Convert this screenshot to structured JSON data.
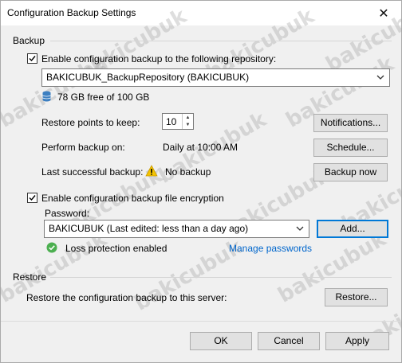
{
  "window": {
    "title": "Configuration Backup Settings",
    "close_glyph": "✕"
  },
  "backup": {
    "group_label": "Backup",
    "enable_label": "Enable configuration backup to the following repository:",
    "enable_checked": true,
    "repository": "BAKICUBUK_BackupRepository (BAKICUBUK)",
    "storage_text": "78 GB free of 100 GB",
    "restore_points_label": "Restore points to keep:",
    "restore_points_value": "10",
    "notifications_button": "Notifications...",
    "perform_label": "Perform backup on:",
    "perform_value": "Daily at 10:00 AM",
    "schedule_button": "Schedule...",
    "last_label": "Last successful backup:",
    "last_value": "No backup",
    "backup_now_button": "Backup now",
    "encryption_label": "Enable configuration backup file encryption",
    "encryption_checked": true,
    "password_label": "Password:",
    "password_value": "BAKICUBUK (Last edited: less than a day ago)",
    "add_button": "Add...",
    "loss_protection": "Loss protection enabled",
    "manage_passwords": "Manage passwords"
  },
  "restore": {
    "group_label": "Restore",
    "restore_text": "Restore the configuration backup to this server:",
    "restore_button": "Restore..."
  },
  "footer": {
    "ok": "OK",
    "cancel": "Cancel",
    "apply": "Apply"
  },
  "watermark": "bakicubuk",
  "colors": {
    "link": "#0066cc",
    "focus": "#0078d7",
    "warning": "#f5c400",
    "ok_green": "#4caf50",
    "db_blue": "#3c7fc1"
  }
}
